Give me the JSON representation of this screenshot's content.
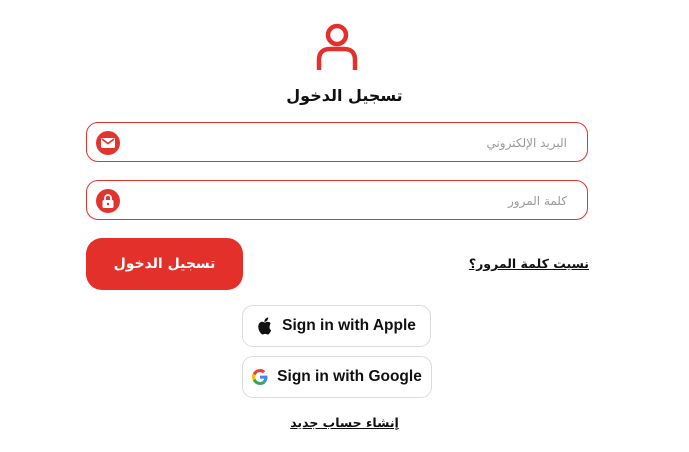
{
  "header": {
    "title": "تسجيل الدخول"
  },
  "form": {
    "email_placeholder": "البريد الإلكتروني",
    "password_placeholder": "كلمة المرور",
    "login_button": "تسجيل الدخول",
    "forgot_password": "نسيت كلمة المرور؟"
  },
  "social": {
    "apple_label": "Sign in with Apple",
    "google_label": "Sign in with Google"
  },
  "footer": {
    "create_account": "إنشاء حساب جديد"
  },
  "icons": {
    "header": "user-icon",
    "email": "mail-icon",
    "password": "lock-icon",
    "apple": "apple-icon",
    "google": "google-icon"
  },
  "colors": {
    "accent": "#e3302b",
    "text": "#111111",
    "placeholder": "#9a9a9a"
  }
}
